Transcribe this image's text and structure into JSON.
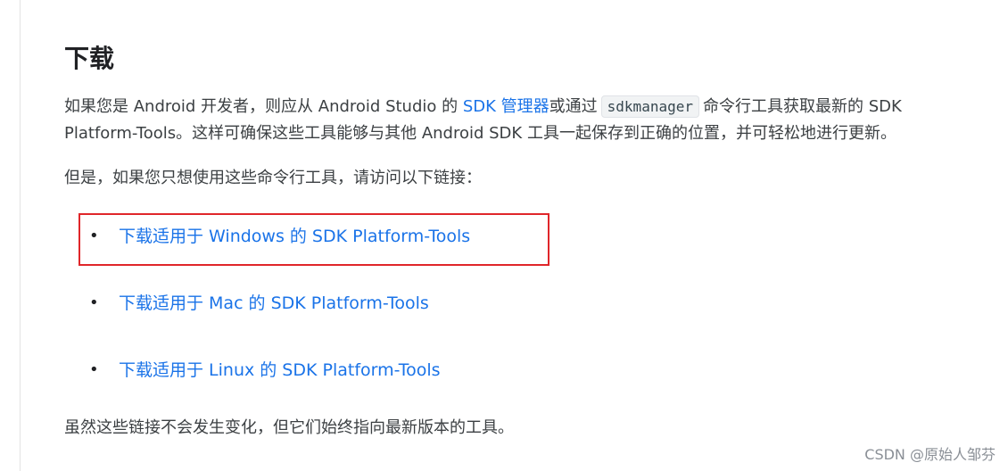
{
  "section": {
    "heading": "下载"
  },
  "intro": {
    "line1_a": "如果您是 Android 开发者，则应从 Android Studio 的 ",
    "sdk_manager_link": "SDK 管理器",
    "line1_b": "或通过",
    "code": "sdkmanager",
    "line1_c": "命令行工具获取最新的 SDK",
    "line2": "Platform-Tools。这样可确保这些工具能够与其他 Android SDK 工具一起保存到正确的位置，并可轻松地进行更新。"
  },
  "subintro": "但是，如果您只想使用这些命令行工具，请访问以下链接：",
  "downloads": [
    {
      "bullet": "•",
      "label": "下载适用于 Windows 的 SDK Platform-Tools"
    },
    {
      "bullet": "•",
      "label": "下载适用于 Mac 的 SDK Platform-Tools"
    },
    {
      "bullet": "•",
      "label": "下载适用于 Linux 的 SDK Platform-Tools"
    }
  ],
  "footnote": "虽然这些链接不会发生变化，但它们始终指向最新版本的工具。",
  "watermark": "CSDN @原始人邹芬",
  "colors": {
    "link": "#1a73e8",
    "highlight_border": "#e0262a",
    "text": "#3c4043"
  }
}
